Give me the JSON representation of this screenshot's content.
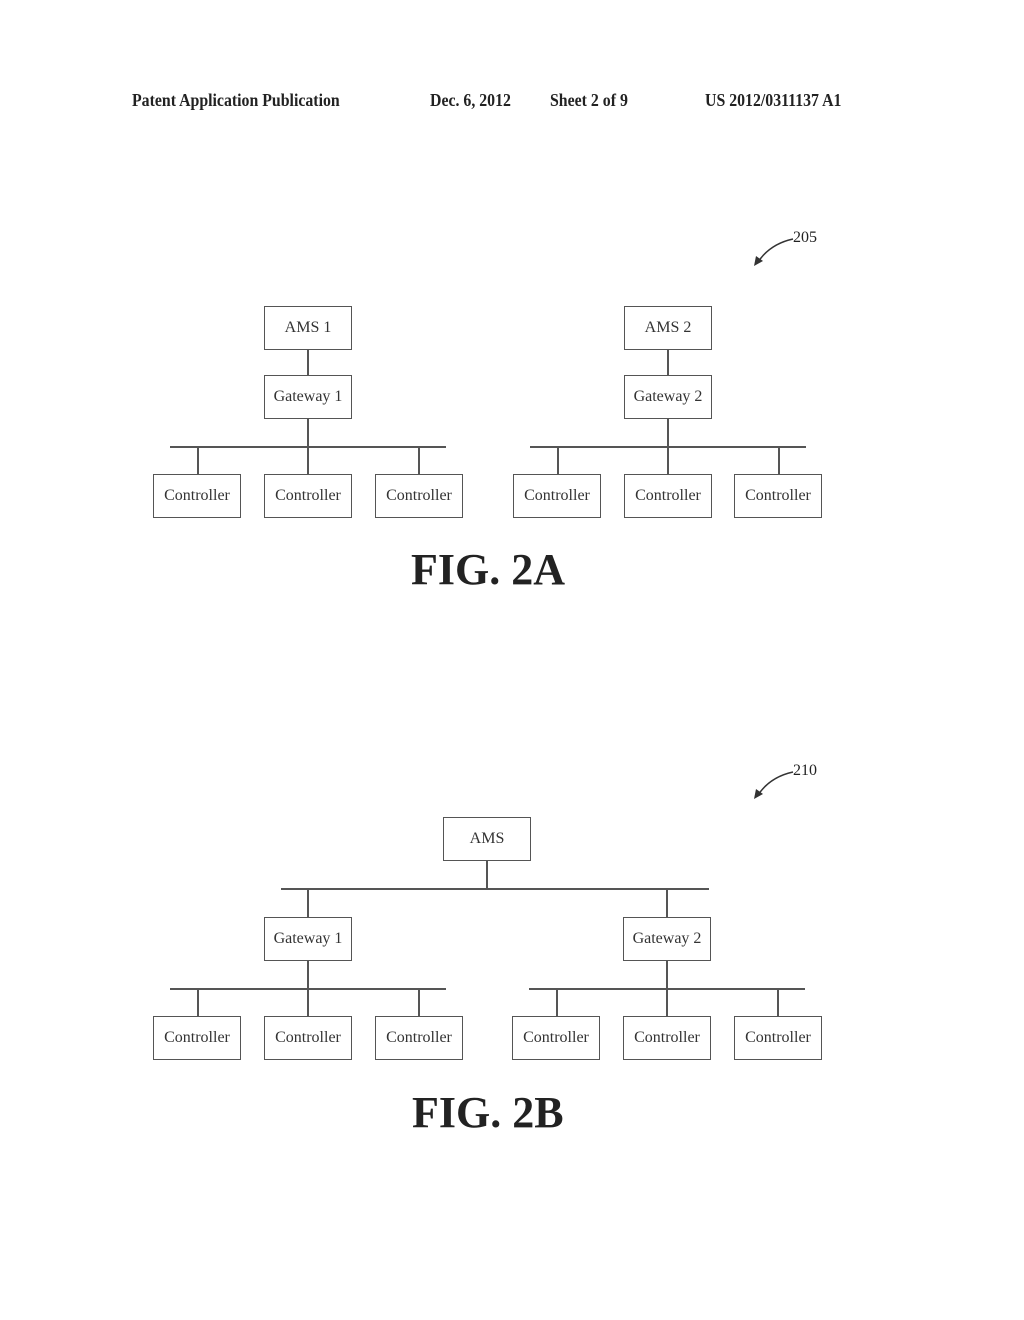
{
  "header": {
    "publication": "Patent Application Publication",
    "date": "Dec. 6, 2012",
    "sheet": "Sheet 2 of 9",
    "number": "US 2012/0311137 A1"
  },
  "fig2a": {
    "ref": "205",
    "caption": "FIG. 2A",
    "ams1": "AMS 1",
    "ams2": "AMS 2",
    "gateway1": "Gateway 1",
    "gateway2": "Gateway 2",
    "controllers": [
      "Controller",
      "Controller",
      "Controller",
      "Controller",
      "Controller",
      "Controller"
    ]
  },
  "fig2b": {
    "ref": "210",
    "caption": "FIG. 2B",
    "ams": "AMS",
    "gateway1": "Gateway 1",
    "gateway2": "Gateway 2",
    "controllers": [
      "Controller",
      "Controller",
      "Controller",
      "Controller",
      "Controller",
      "Controller"
    ]
  }
}
